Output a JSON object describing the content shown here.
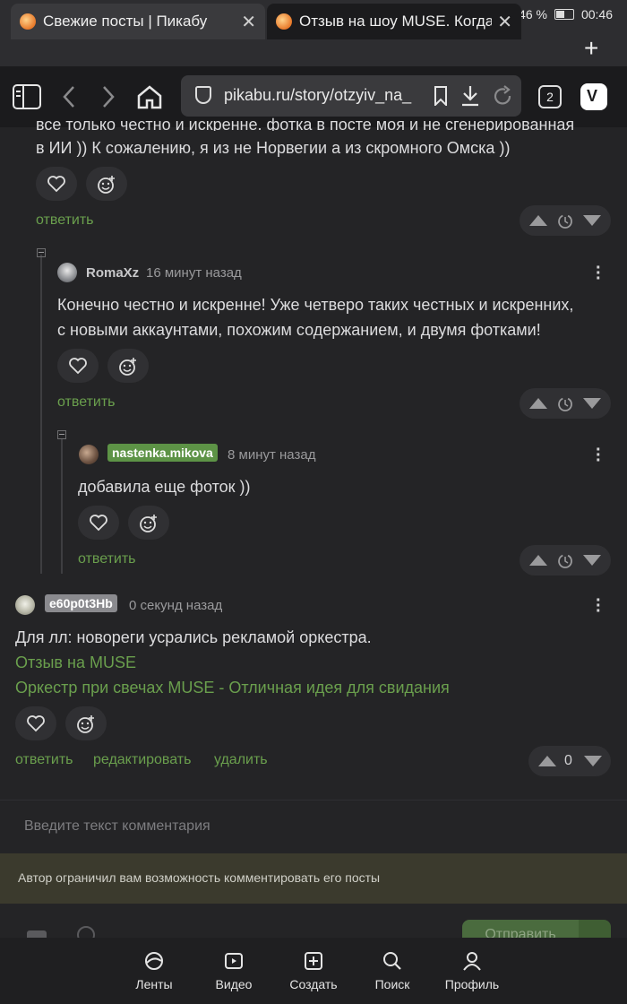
{
  "status": {
    "battery": "46 %",
    "time": "00:46"
  },
  "tabs": [
    {
      "title": "Свежие посты | Пикабу"
    },
    {
      "title": "Отзыв на шоу MUSE. Когда за"
    }
  ],
  "address": {
    "url": "pikabu.ru/story/otzyiv_na_",
    "tab_count": "2"
  },
  "comments": {
    "top_partial_line1": "все только честно и искренне. фотка в посте моя и не сгенерированная",
    "top_partial_line2": "в ИИ )) К сожалению, я из не Норвегии а из скромного Омска ))",
    "reply1": {
      "author": "RomaXz",
      "time": "16 минут назад",
      "text_line1": "Конечно честно и искренне! Уже четверо таких честных и искренних,",
      "text_line2": "с новыми аккаунтами, похожим содержанием, и двумя фотками!"
    },
    "reply2": {
      "author": "nastenka.mikova",
      "time": "8 минут назад",
      "text": "добавила еще фоток ))"
    },
    "own": {
      "author": "e60p0t3Hb",
      "time": "0 секунд назад",
      "text": "Для лл: новореги усрались рекламой оркестра.",
      "link1": "Отзыв на MUSE",
      "link2": "Оркестр при свечах MUSE - Отличная идея для свидания",
      "rating": "0"
    },
    "reply_label": "ответить",
    "edit_label": "редактировать",
    "delete_label": "удалить"
  },
  "composer": {
    "placeholder": "Введите текст комментария",
    "notice": "Автор ограничил вам возможность комментировать его посты",
    "send_label": "Отправить"
  },
  "nav": [
    {
      "label": "Ленты",
      "icon": "feeds-icon"
    },
    {
      "label": "Видео",
      "icon": "video-icon"
    },
    {
      "label": "Создать",
      "icon": "create-icon"
    },
    {
      "label": "Поиск",
      "icon": "search-icon"
    },
    {
      "label": "Профиль",
      "icon": "profile-icon"
    }
  ],
  "colors": {
    "accent": "#6a9f4d",
    "background": "#242426",
    "notice_bg": "#3b3a2d"
  }
}
